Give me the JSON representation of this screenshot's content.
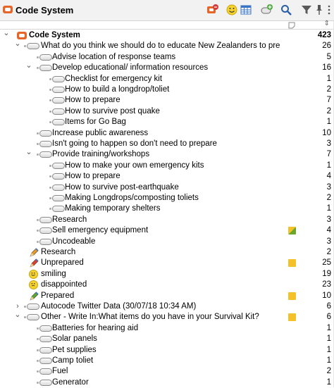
{
  "window": {
    "title": "Code System"
  },
  "toolbar": {
    "icons": [
      "video-code-icon",
      "emoticon-icon",
      "table-grid-icon",
      "add-code-icon",
      "search-icon",
      "filter-icon",
      "pin-icon",
      "more-icon"
    ]
  },
  "header": {
    "sort_indicator": "⇕"
  },
  "rows": [
    {
      "label": "Code System",
      "count": "423",
      "level": 0,
      "icon": "root",
      "toggle": "v",
      "bold": true
    },
    {
      "label": "What do you think we should do to educate New Zealanders to pre",
      "count": "26",
      "level": 1,
      "icon": "code",
      "toggle": "v"
    },
    {
      "label": "Advise location of response teams",
      "count": "5",
      "level": 2,
      "icon": "code"
    },
    {
      "label": "Develop educational/ information resources",
      "count": "16",
      "level": 2,
      "icon": "code",
      "toggle": "v"
    },
    {
      "label": "Checklist for emergency kit",
      "count": "1",
      "level": 3,
      "icon": "code"
    },
    {
      "label": "How to build a longdrop/toliet",
      "count": "2",
      "level": 3,
      "icon": "code"
    },
    {
      "label": "How to prepare",
      "count": "7",
      "level": 3,
      "icon": "code"
    },
    {
      "label": "How to survive post quake",
      "count": "2",
      "level": 3,
      "icon": "code"
    },
    {
      "label": "Items for Go Bag",
      "count": "1",
      "level": 3,
      "icon": "code"
    },
    {
      "label": "Increase public awareness",
      "count": "10",
      "level": 2,
      "icon": "code"
    },
    {
      "label": "Isn't going to happen so don't need to prepare",
      "count": "3",
      "level": 2,
      "icon": "code"
    },
    {
      "label": "Provide training/workshops",
      "count": "7",
      "level": 2,
      "icon": "code",
      "toggle": "v"
    },
    {
      "label": "How to make your own emergency kits",
      "count": "1",
      "level": 3,
      "icon": "code"
    },
    {
      "label": "How to prepare",
      "count": "4",
      "level": 3,
      "icon": "code"
    },
    {
      "label": "How to survive post-earthquake",
      "count": "3",
      "level": 3,
      "icon": "code"
    },
    {
      "label": "Making Longdrops/composting toliets",
      "count": "2",
      "level": 3,
      "icon": "code"
    },
    {
      "label": "Making temporary shelters",
      "count": "1",
      "level": 3,
      "icon": "code"
    },
    {
      "label": "Research",
      "count": "3",
      "level": 2,
      "icon": "code"
    },
    {
      "label": "Sell emergency equipment",
      "count": "4",
      "level": 2,
      "icon": "code",
      "memo": "green"
    },
    {
      "label": "Uncodeable",
      "count": "3",
      "level": 2,
      "icon": "code"
    },
    {
      "label": "Research",
      "count": "2",
      "level": 1,
      "icon": "pencil-orange"
    },
    {
      "label": "Unprepared",
      "count": "25",
      "level": 1,
      "icon": "pencil-red",
      "memo": "yellow"
    },
    {
      "label": "smiling",
      "count": "19",
      "level": 1,
      "icon": "smile"
    },
    {
      "label": "disappointed",
      "count": "23",
      "level": 1,
      "icon": "frown"
    },
    {
      "label": "Prepared",
      "count": "10",
      "level": 1,
      "icon": "pencil-green",
      "memo": "yellow"
    },
    {
      "label": "Autocode Twitter Data (30/07/18 10:34 AM)",
      "count": "6",
      "level": 1,
      "icon": "code",
      "toggle": ">"
    },
    {
      "label": "Other - Write In:What items do you have in your Survival Kit?",
      "count": "6",
      "level": 1,
      "icon": "code",
      "toggle": "v",
      "memo": "yellow"
    },
    {
      "label": "Batteries for hearing aid",
      "count": "1",
      "level": 2,
      "icon": "code"
    },
    {
      "label": "Solar panels",
      "count": "1",
      "level": 2,
      "icon": "code"
    },
    {
      "label": "Pet supplies",
      "count": "1",
      "level": 2,
      "icon": "code"
    },
    {
      "label": "Camp toliet",
      "count": "1",
      "level": 2,
      "icon": "code"
    },
    {
      "label": "Fuel",
      "count": "2",
      "level": 2,
      "icon": "code"
    },
    {
      "label": "Generator",
      "count": "1",
      "level": 2,
      "icon": "code"
    }
  ]
}
